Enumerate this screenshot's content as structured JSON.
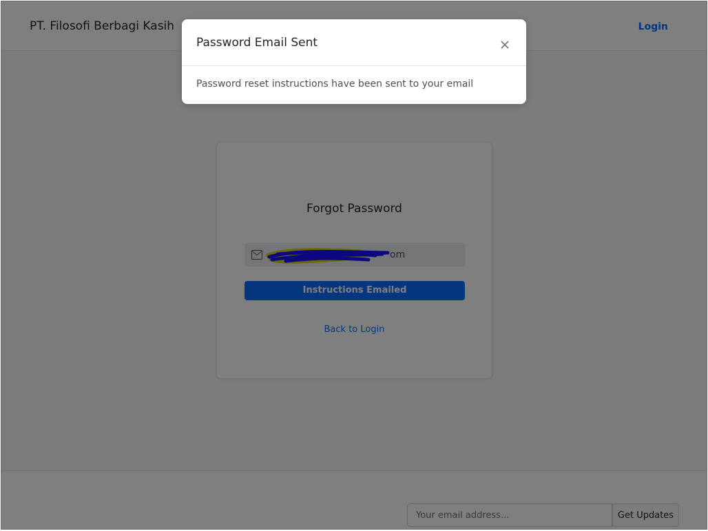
{
  "navbar": {
    "brand": "PT. Filosofi Berbagi Kasih",
    "login_link": "Login"
  },
  "forgot_password": {
    "title": "Forgot Password",
    "email_icon": "envelope-icon",
    "email_value": "",
    "email_visible_tail": "om",
    "submit_label": "Instructions Emailed",
    "back_link": "Back to Login"
  },
  "footer": {
    "subscribe_placeholder": "Your email address...",
    "subscribe_button": "Get Updates"
  },
  "modal": {
    "title": "Password Email Sent",
    "close_icon": "close-icon",
    "body": "Password reset instructions have been sent to your email"
  },
  "colors": {
    "primary": "#0d6efd",
    "backdrop": "rgba(0,0,0,0.5)"
  }
}
